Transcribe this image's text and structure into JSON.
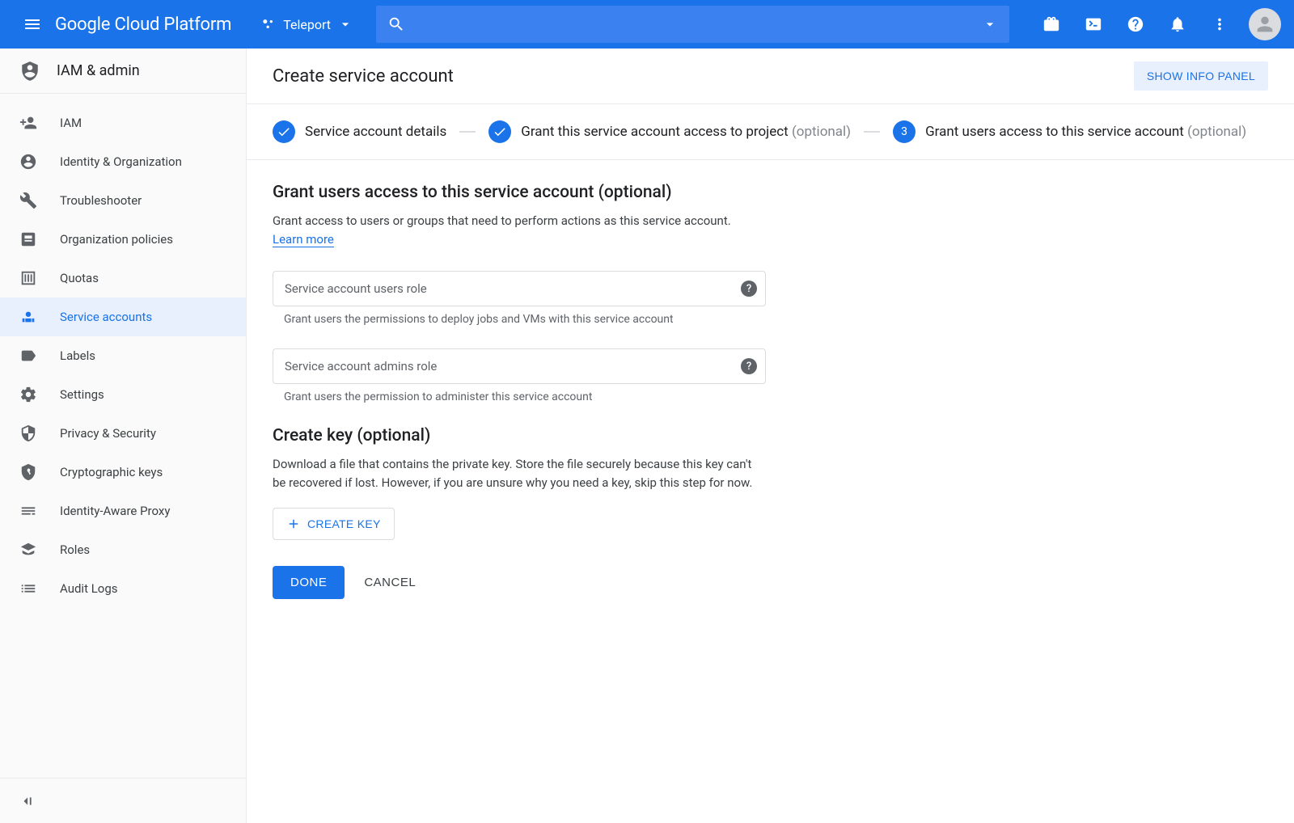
{
  "header": {
    "logo": "Google Cloud Platform",
    "project": "Teleport"
  },
  "sidebar": {
    "title": "IAM & admin",
    "items": [
      {
        "label": "IAM"
      },
      {
        "label": "Identity & Organization"
      },
      {
        "label": "Troubleshooter"
      },
      {
        "label": "Organization policies"
      },
      {
        "label": "Quotas"
      },
      {
        "label": "Service accounts"
      },
      {
        "label": "Labels"
      },
      {
        "label": "Settings"
      },
      {
        "label": "Privacy & Security"
      },
      {
        "label": "Cryptographic keys"
      },
      {
        "label": "Identity-Aware Proxy"
      },
      {
        "label": "Roles"
      },
      {
        "label": "Audit Logs"
      }
    ]
  },
  "main": {
    "title": "Create service account",
    "info_panel": "SHOW INFO PANEL",
    "steps": {
      "s1": "Service account details",
      "s2": "Grant this service account access to project",
      "s2_opt": "(optional)",
      "s3_num": "3",
      "s3": "Grant users access to this service account",
      "s3_opt": "(optional)"
    },
    "grant_section": {
      "title": "Grant users access to this service account (optional)",
      "desc": "Grant access to users or groups that need to perform actions as this service account.",
      "learn_more": "Learn more",
      "field1_label": "Service account users role",
      "field1_hint": "Grant users the permissions to deploy jobs and VMs with this service account",
      "field2_label": "Service account admins role",
      "field2_hint": "Grant users the permission to administer this service account"
    },
    "key_section": {
      "title": "Create key (optional)",
      "desc": "Download a file that contains the private key. Store the file securely because this key can't be recovered if lost. However, if you are unsure why you need a key, skip this step for now.",
      "button": "CREATE KEY"
    },
    "actions": {
      "done": "DONE",
      "cancel": "CANCEL"
    }
  }
}
